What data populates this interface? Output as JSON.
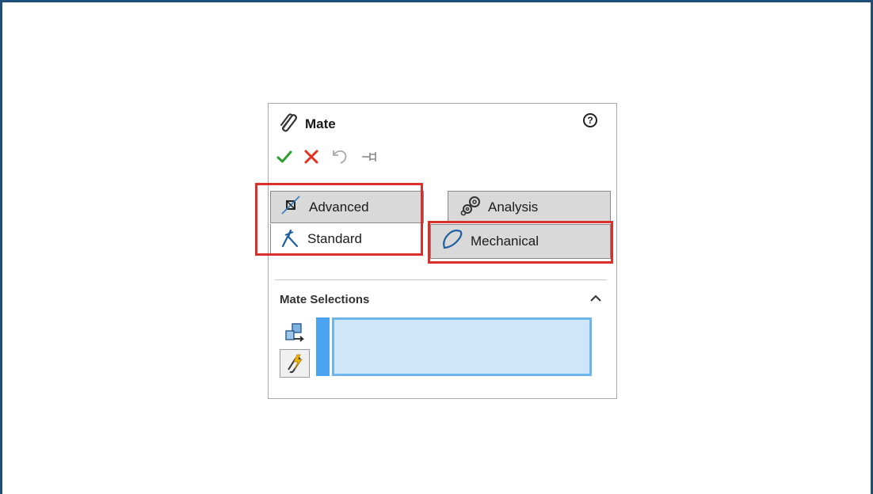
{
  "panel": {
    "title": "Mate",
    "title_icon": "paperclip-icon",
    "help_icon": "help-icon",
    "help_glyph": "?"
  },
  "actions": [
    {
      "name": "ok",
      "icon": "checkmark-icon",
      "color": "#2e9e2e"
    },
    {
      "name": "cancel",
      "icon": "close-icon",
      "color": "#e0301e"
    },
    {
      "name": "undo",
      "icon": "undo-icon",
      "color": "#a0a0a0"
    },
    {
      "name": "pin",
      "icon": "pushpin-icon",
      "color": "#808080"
    }
  ],
  "tabs": {
    "advanced": {
      "label": "Advanced",
      "icon": "advanced-mate-icon"
    },
    "analysis": {
      "label": "Analysis",
      "icon": "gears-icon"
    },
    "standard": {
      "label": "Standard",
      "icon": "standard-mate-icon"
    },
    "mechanical": {
      "label": "Mechanical",
      "icon": "cam-icon"
    }
  },
  "highlight_color": "#d9302c",
  "mate_selections": {
    "header": "Mate Selections",
    "collapse_icon": "chevron-up-icon",
    "selection_value": "",
    "accent": "#4aa3f0",
    "box_fill": "#cfe5f8"
  },
  "frame_color": "#1f4e79"
}
